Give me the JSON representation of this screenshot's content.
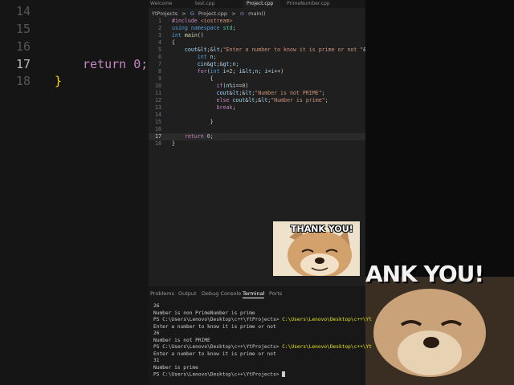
{
  "background_left": {
    "lines": [
      {
        "num": "14",
        "text": ""
      },
      {
        "num": "15",
        "text": ""
      },
      {
        "num": "16",
        "text": ""
      },
      {
        "num": "17",
        "text": "return 0;"
      },
      {
        "num": "18",
        "text": "}"
      }
    ]
  },
  "background_right": {
    "overlay_text": "ANK YOU!"
  },
  "tabs": [
    {
      "label": "Welcome"
    },
    {
      "label": "test.cpp"
    },
    {
      "label": "Project.cpp"
    },
    {
      "label": "PrimeNumber.cpp"
    }
  ],
  "breadcrumb": {
    "folder": "YtProjects",
    "sep": ">",
    "file": "Project.cpp",
    "symbol": "main()"
  },
  "code": {
    "lines": [
      {
        "num": "1",
        "text": "#include <iostream>"
      },
      {
        "num": "2",
        "text": "using namespace std;"
      },
      {
        "num": "3",
        "text": "int main()"
      },
      {
        "num": "4",
        "text": "{"
      },
      {
        "num": "5",
        "text": "    cout<<\"Enter a number to know it is prime or not \"<<endl;"
      },
      {
        "num": "6",
        "text": "        int n;"
      },
      {
        "num": "7",
        "text": "        cin>>n;"
      },
      {
        "num": "8",
        "text": "        for(int i=2; i<n; i=i++)"
      },
      {
        "num": "9",
        "text": "            {"
      },
      {
        "num": "10",
        "text": "              if(n%i==0)"
      },
      {
        "num": "11",
        "text": "              cout<<\"Number is not PRIME\";"
      },
      {
        "num": "12",
        "text": "              else cout<<\"Number is prime\";"
      },
      {
        "num": "13",
        "text": "              break;"
      },
      {
        "num": "14",
        "text": ""
      },
      {
        "num": "15",
        "text": "            }"
      },
      {
        "num": "16",
        "text": ""
      },
      {
        "num": "17",
        "text": "    return 0;"
      },
      {
        "num": "18",
        "text": "}"
      }
    ],
    "current_line": "17"
  },
  "gif": {
    "caption": "THANK YOU!"
  },
  "panel": {
    "tabs": [
      {
        "label": "Problems"
      },
      {
        "label": "Output"
      },
      {
        "label": "Debug Console"
      },
      {
        "label": "Terminal",
        "active": true
      },
      {
        "label": "Ports"
      }
    ]
  },
  "terminal": {
    "lines": [
      {
        "text": "26"
      },
      {
        "text": "Number is non PrimeNumber is prime"
      },
      {
        "prefix": "PS ",
        "path": "C:\\Users\\Lenovo\\Desktop\\c++\\YtProjects>",
        "cmd": " C:\\Users\\Lenovo\\Desktop\\c++\\Yt"
      },
      {
        "text": "Enter a number to know it is prime or not"
      },
      {
        "text": "26"
      },
      {
        "text": "Number is not PRIME"
      },
      {
        "prefix": "PS ",
        "path": "C:\\Users\\Lenovo\\Desktop\\c++\\YtProjects>",
        "cmd": " C:\\Users\\Lenovo\\Desktop\\c++\\Yt"
      },
      {
        "text": "Enter a number to know it is prime or not"
      },
      {
        "text": "31"
      },
      {
        "text": "Number is prime"
      },
      {
        "prefix": "PS ",
        "path": "C:\\Users\\Lenovo\\Desktop\\c++\\YtProjects>",
        "cmd": " "
      }
    ]
  }
}
